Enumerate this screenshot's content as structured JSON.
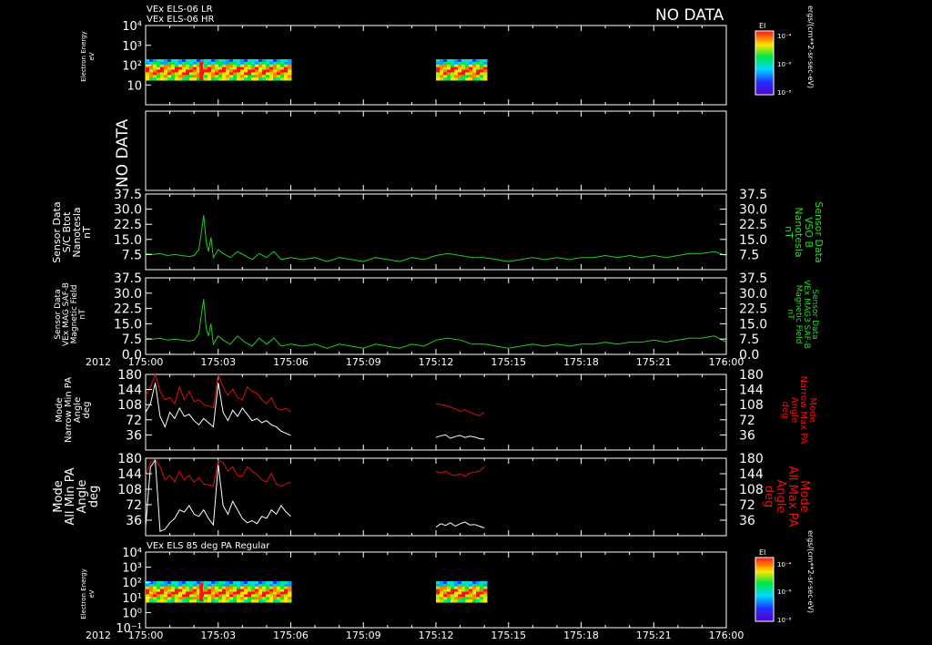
{
  "header": {
    "line1": "VEx ELS-06 LR",
    "line2": "VEx ELS-06 HR",
    "no_data": "NO DATA"
  },
  "time_axis": {
    "year": "2012",
    "ticks": [
      "175:00",
      "175:03",
      "175:06",
      "175:09",
      "175:12",
      "175:15",
      "175:18",
      "175:21",
      "176:00"
    ]
  },
  "colors": {
    "background": "#000000",
    "axes": "#ffffff",
    "green_trace": "#22cc22",
    "red_trace": "#dd1111",
    "white_trace": "#ffffff",
    "green_label": "#22dd22",
    "red_label": "#ee1111"
  },
  "colorbar": {
    "title": "EI",
    "ticks": [
      "10⁻⁴",
      "10⁻⁶",
      "10⁻⁸"
    ],
    "units": "ergs/(cm**2-sr-sec-eV)"
  },
  "spectrogram_labels": {
    "top_title": "",
    "bottom_title": "VEx ELS 85 deg PA Regular",
    "ylabel": [
      "Electron Energy",
      "eV"
    ],
    "top_yticks": [
      "10⁴",
      "10³",
      "10²",
      "10"
    ],
    "bottom_yticks": [
      "10⁴",
      "10³",
      "10²",
      "10¹",
      "10⁰",
      "10⁻¹"
    ]
  },
  "panel2": {
    "label": "NO DATA"
  },
  "panel3": {
    "left_label": [
      "Sensor Data",
      "S/C Btot",
      "Nanotesla",
      "nT"
    ],
    "right_label": [
      "Sensor Data",
      "VSO B",
      "Nanotesla",
      "nT"
    ],
    "yticks": [
      "37.5",
      "30.0",
      "22.5",
      "15.0",
      "7.5"
    ]
  },
  "panel4": {
    "left_label": [
      "Sensor Data",
      "VEx MAG SAF-B",
      "Magnetic Field",
      "nT"
    ],
    "right_label": [
      "Sensor Data",
      "VEx MAG3 SAF-B",
      "Magnetic Field",
      "nT"
    ],
    "yticks": [
      "37.5",
      "30.0",
      "22.5",
      "15.0",
      "7.5",
      "0.0"
    ]
  },
  "panel5": {
    "left_label": [
      "Mode",
      "Narrow Min PA",
      "Angle",
      "deg"
    ],
    "right_label": [
      "Mode",
      "Narrow Max PA",
      "Angle",
      "deg"
    ],
    "yticks": [
      "180",
      "144",
      "108",
      "72",
      "36"
    ]
  },
  "panel6": {
    "left_label": [
      "Mode",
      "All Min PA",
      "Angle",
      "deg"
    ],
    "right_label": [
      "Mode",
      "All Max PA",
      "Angle",
      "deg"
    ],
    "yticks": [
      "180",
      "144",
      "108",
      "72",
      "36"
    ]
  },
  "chart_data": [
    {
      "type": "heatmap",
      "title": "VEx ELS-06 LR / VEx ELS-06 HR",
      "ylabel": "Electron Energy eV",
      "yscale": "log",
      "ylim": [
        1,
        10000
      ],
      "x_unit": "minutes after 175:00",
      "data_intervals": [
        [
          0,
          6
        ],
        [
          12,
          14
        ]
      ],
      "zlabel": "EI ergs/(cm**2-sr-sec-eV)",
      "zlim_log10": [
        -8,
        -4
      ]
    },
    {
      "type": "line",
      "title": "NO DATA",
      "series": []
    },
    {
      "type": "line",
      "ylabel": "Sensor Data S/C Btot Nanotesla nT",
      "ylabel_right": "Sensor Data VSO B Nanotesla nT",
      "ylim": [
        0,
        37.5
      ],
      "x_unit": "minutes after 175:00",
      "series": [
        {
          "color": "#22cc22",
          "x": [
            0,
            0.3,
            0.6,
            0.9,
            1.2,
            1.5,
            1.8,
            2.0,
            2.2,
            2.3,
            2.4,
            2.5,
            2.6,
            2.7,
            2.8,
            3.0,
            3.2,
            3.5,
            3.8,
            4.1,
            4.4,
            4.7,
            5.0,
            5.3,
            5.6,
            6.0,
            6.5,
            7.0,
            7.5,
            8.0,
            8.5,
            9.0,
            9.5,
            10.0,
            10.5,
            11.0,
            11.5,
            12.0,
            12.5,
            13.0,
            13.5,
            14.0,
            14.5,
            15.0,
            15.5,
            16.0,
            16.5,
            17.0,
            17.5,
            18.0,
            18.5,
            19.0,
            19.5,
            20.0,
            20.5,
            21.0,
            21.5,
            22.0,
            22.5,
            23.0,
            23.5,
            24.0
          ],
          "y": [
            8,
            7.5,
            8,
            7,
            7.5,
            7,
            6.5,
            7,
            10,
            18,
            27,
            14,
            9,
            16,
            6,
            10,
            8,
            6,
            9,
            7,
            5,
            8,
            6,
            9,
            5,
            6,
            5,
            6,
            4,
            6,
            5,
            4,
            6,
            5,
            4,
            6,
            5,
            7,
            8,
            7,
            6,
            6,
            5,
            4,
            5,
            6,
            5,
            6,
            5,
            6,
            6,
            7,
            6,
            7,
            6,
            7,
            6,
            7,
            8,
            8,
            9,
            7
          ]
        }
      ]
    },
    {
      "type": "line",
      "ylabel": "Sensor Data VEx MAG SAF-B Magnetic Field nT",
      "ylabel_right": "Sensor Data VEx MAG3 SAF-B Magnetic Field nT",
      "ylim": [
        0,
        37.5
      ],
      "x_unit": "minutes after 175:00",
      "series": [
        {
          "color": "#22cc22",
          "x": [
            0,
            0.3,
            0.6,
            0.9,
            1.2,
            1.5,
            1.8,
            2.0,
            2.2,
            2.3,
            2.4,
            2.5,
            2.6,
            2.7,
            2.8,
            3.0,
            3.2,
            3.5,
            3.8,
            4.1,
            4.4,
            4.7,
            5.0,
            5.3,
            5.6,
            6.0,
            6.5,
            7.0,
            7.5,
            8.0,
            8.5,
            9.0,
            9.5,
            10.0,
            10.5,
            11.0,
            11.5,
            12.0,
            12.5,
            13.0,
            13.5,
            14.0,
            14.5,
            15.0,
            15.5,
            16.0,
            16.5,
            17.0,
            17.5,
            18.0,
            18.5,
            19.0,
            19.5,
            20.0,
            20.5,
            21.0,
            21.5,
            22.0,
            22.5,
            23.0,
            23.5,
            24.0
          ],
          "y": [
            8,
            7.5,
            8,
            7,
            7.5,
            7,
            6.5,
            7,
            10,
            19,
            27,
            13,
            9,
            15,
            5,
            9,
            7,
            5,
            9,
            6,
            4,
            8,
            5,
            8,
            4,
            5,
            4,
            5,
            3,
            5,
            4,
            3,
            5,
            4,
            3,
            5,
            4,
            7,
            8,
            7,
            5,
            5,
            4,
            3,
            4,
            5,
            4,
            5,
            4,
            5,
            5,
            6,
            5,
            6,
            6,
            7,
            6,
            7,
            8,
            8,
            9,
            6
          ]
        }
      ]
    },
    {
      "type": "line",
      "ylabel": "Mode Narrow Min PA Angle deg",
      "ylabel_right": "Mode Narrow Max PA Angle deg",
      "ylim": [
        0,
        180
      ],
      "x_unit": "minutes after 175:00",
      "series": [
        {
          "name": "Narrow Max PA",
          "color": "#dd1111",
          "x": [
            0,
            0.2,
            0.4,
            0.6,
            0.8,
            1.0,
            1.2,
            1.4,
            1.6,
            1.8,
            2.0,
            2.2,
            2.4,
            2.6,
            2.8,
            3.0,
            3.2,
            3.4,
            3.6,
            3.8,
            4.0,
            4.2,
            4.4,
            4.6,
            4.8,
            5.0,
            5.2,
            5.4,
            5.6,
            5.8,
            6.0,
            null,
            12.0,
            12.2,
            12.4,
            12.6,
            12.8,
            13.0,
            13.2,
            13.4,
            13.6,
            13.8,
            14.0
          ],
          "y": [
            130,
            150,
            180,
            140,
            120,
            125,
            110,
            150,
            120,
            140,
            115,
            120,
            108,
            105,
            100,
            180,
            150,
            130,
            145,
            125,
            120,
            150,
            140,
            135,
            120,
            110,
            125,
            100,
            95,
            100,
            90,
            null,
            110,
            108,
            106,
            102,
            98,
            92,
            96,
            90,
            85,
            82,
            90
          ]
        },
        {
          "name": "Narrow Min PA",
          "color": "#ffffff",
          "x": [
            0,
            0.2,
            0.4,
            0.6,
            0.8,
            1.0,
            1.2,
            1.4,
            1.6,
            1.8,
            2.0,
            2.2,
            2.4,
            2.6,
            2.8,
            3.0,
            3.2,
            3.4,
            3.6,
            3.8,
            4.0,
            4.2,
            4.4,
            4.6,
            4.8,
            5.0,
            5.2,
            5.4,
            5.6,
            5.8,
            6.0,
            null,
            12.0,
            12.2,
            12.4,
            12.6,
            12.8,
            13.0,
            13.2,
            13.4,
            13.6,
            13.8,
            14.0
          ],
          "y": [
            90,
            110,
            160,
            80,
            55,
            90,
            75,
            100,
            80,
            85,
            70,
            60,
            75,
            65,
            55,
            160,
            90,
            70,
            95,
            80,
            100,
            85,
            70,
            75,
            65,
            70,
            60,
            55,
            45,
            40,
            35,
            null,
            30,
            34,
            36,
            28,
            32,
            35,
            30,
            33,
            31,
            27,
            26
          ]
        }
      ]
    },
    {
      "type": "line",
      "ylabel": "Mode All Min PA Angle deg",
      "ylabel_right": "Mode All Max PA Angle deg",
      "ylim": [
        0,
        180
      ],
      "x_unit": "minutes after 175:00",
      "series": [
        {
          "name": "All Max PA",
          "color": "#dd1111",
          "x": [
            0,
            0.2,
            0.4,
            0.6,
            0.8,
            1.0,
            1.2,
            1.4,
            1.6,
            1.8,
            2.0,
            2.2,
            2.4,
            2.6,
            2.8,
            3.0,
            3.2,
            3.4,
            3.6,
            3.8,
            4.0,
            4.2,
            4.4,
            4.6,
            4.8,
            5.0,
            5.2,
            5.4,
            5.6,
            5.8,
            6.0,
            null,
            12.0,
            12.2,
            12.4,
            12.6,
            12.8,
            13.0,
            13.2,
            13.4,
            13.6,
            13.8,
            14.0
          ],
          "y": [
            140,
            170,
            178,
            160,
            130,
            140,
            125,
            150,
            130,
            140,
            125,
            135,
            120,
            118,
            115,
            175,
            170,
            150,
            160,
            140,
            138,
            160,
            150,
            142,
            130,
            125,
            145,
            120,
            115,
            120,
            125,
            null,
            150,
            146,
            150,
            142,
            140,
            144,
            138,
            145,
            148,
            150,
            160
          ]
        },
        {
          "name": "All Min PA",
          "color": "#ffffff",
          "x": [
            0,
            0.2,
            0.4,
            0.6,
            0.8,
            1.0,
            1.2,
            1.4,
            1.6,
            1.8,
            2.0,
            2.2,
            2.4,
            2.6,
            2.8,
            3.0,
            3.2,
            3.4,
            3.6,
            3.8,
            4.0,
            4.2,
            4.4,
            4.6,
            4.8,
            5.0,
            5.2,
            5.4,
            5.6,
            5.8,
            6.0,
            null,
            12.0,
            12.2,
            12.4,
            12.6,
            12.8,
            13.0,
            13.2,
            13.4,
            13.6,
            13.8,
            14.0
          ],
          "y": [
            20,
            160,
            175,
            10,
            15,
            30,
            40,
            60,
            55,
            70,
            50,
            45,
            60,
            40,
            25,
            165,
            70,
            50,
            80,
            60,
            40,
            30,
            35,
            28,
            45,
            40,
            60,
            50,
            70,
            55,
            45,
            null,
            20,
            28,
            24,
            30,
            22,
            28,
            32,
            25,
            26,
            22,
            18
          ]
        }
      ]
    },
    {
      "type": "heatmap",
      "title": "VEx ELS 85 deg PA Regular",
      "ylabel": "Electron Energy eV",
      "yscale": "log",
      "ylim": [
        0.1,
        10000
      ],
      "x_unit": "minutes after 175:00",
      "data_intervals": [
        [
          0,
          6
        ],
        [
          12,
          14
        ]
      ],
      "zlabel": "EI ergs/(cm**2-sr-sec-eV)",
      "zlim_log10": [
        -8,
        -4
      ]
    }
  ]
}
